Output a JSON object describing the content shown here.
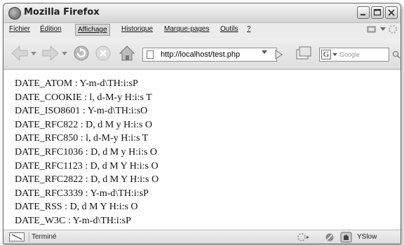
{
  "window": {
    "title": "Mozilla Firefox"
  },
  "menu": {
    "items": [
      {
        "label": "Fichier"
      },
      {
        "label": "Édition"
      },
      {
        "label": "Affichage"
      },
      {
        "label": "Historique"
      },
      {
        "label": "Marque-pages"
      },
      {
        "label": "Outils"
      },
      {
        "label": "?"
      }
    ]
  },
  "address_bar": {
    "url": "http://localhost/test.php"
  },
  "search_bar": {
    "engine": "G",
    "placeholder": "Google"
  },
  "page": {
    "lines": [
      "DATE_ATOM : Y-m-d\\TH:i:sP",
      "DATE_COOKIE : l, d-M-y H:i:s T",
      "DATE_ISO8601 : Y-m-d\\TH:i:sO",
      "DATE_RFC822 : D, d M y H:i:s O",
      "DATE_RFC850 : l, d-M-y H:i:s T",
      "DATE_RFC1036 : D, d M y H:i:s O",
      "DATE_RFC1123 : D, d M Y H:i:s O",
      "DATE_RFC2822 : D, d M Y H:i:s O",
      "DATE_RFC3339 : Y-m-d\\TH:i:sP",
      "DATE_RSS : D, d M Y H:i:s O",
      "DATE_W3C : Y-m-d\\TH:i:sP"
    ]
  },
  "status": {
    "text": "Terminé",
    "addon": "YSlow"
  }
}
